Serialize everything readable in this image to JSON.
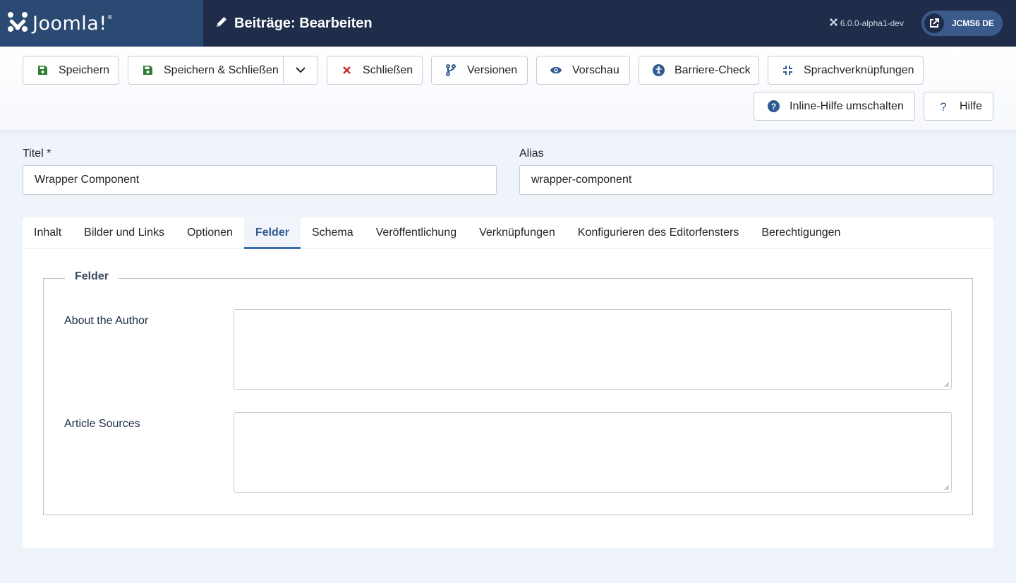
{
  "header": {
    "logo_text": "Joomla!",
    "page_title": "Beiträge: Bearbeiten",
    "version": "6.0.0-alpha1-dev",
    "site_button": "JCMS6 DE",
    "icons": [
      "joomla-logo-icon",
      "pencil-icon",
      "joomla-mini-icon",
      "external-link-icon"
    ]
  },
  "toolbar": {
    "save": "Speichern",
    "save_close": "Speichern & Schließen",
    "close": "Schließen",
    "versions": "Versionen",
    "preview": "Vorschau",
    "accessibility": "Barriere-Check",
    "associations": "Sprachverknüpfungen",
    "inline_help": "Inline-Hilfe umschalten",
    "help": "Hilfe"
  },
  "form": {
    "title_label": "Titel *",
    "title_value": "Wrapper Component",
    "alias_label": "Alias",
    "alias_value": "wrapper-component"
  },
  "tabs": [
    {
      "label": "Inhalt"
    },
    {
      "label": "Bilder und Links"
    },
    {
      "label": "Optionen"
    },
    {
      "label": "Felder",
      "active": true
    },
    {
      "label": "Schema"
    },
    {
      "label": "Veröffentlichung"
    },
    {
      "label": "Verknüpfungen"
    },
    {
      "label": "Konfigurieren des Editorfensters"
    },
    {
      "label": "Berechtigungen"
    }
  ],
  "fields": {
    "legend": "Felder",
    "about_author_label": "About the Author",
    "about_author_value": "",
    "article_sources_label": "Article Sources",
    "article_sources_value": ""
  },
  "colors": {
    "header_bg": "#1f2d4b",
    "logo_bg": "#2b4a73",
    "save_icon": "#2f7d32",
    "close_icon": "#c52827",
    "accent_icon": "#2f5a8f",
    "active_tab": "#2f5a8f"
  }
}
